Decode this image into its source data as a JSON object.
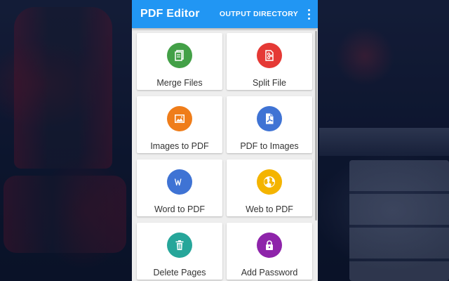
{
  "app": {
    "title": "PDF Editor",
    "action": "OUTPUT DIRECTORY",
    "overflow_icon": "more-vert-icon",
    "accent_color": "#2196f3"
  },
  "tools": [
    {
      "label": "Merge Files",
      "icon": "merge-files-icon",
      "color": "#43a047"
    },
    {
      "label": "Split File",
      "icon": "split-file-icon",
      "color": "#e53935"
    },
    {
      "label": "Images to PDF",
      "icon": "image-icon",
      "color": "#ef7d1a"
    },
    {
      "label": "PDF to Images",
      "icon": "pdf-icon",
      "color": "#3f73d4"
    },
    {
      "label": "Word to PDF",
      "icon": "word-icon",
      "color": "#3f73d4"
    },
    {
      "label": "Web to PDF",
      "icon": "globe-icon",
      "color": "#f4b400"
    },
    {
      "label": "Delete Pages",
      "icon": "trash-icon",
      "color": "#26a69a"
    },
    {
      "label": "Add Password",
      "icon": "lock-icon",
      "color": "#8e24aa"
    }
  ]
}
